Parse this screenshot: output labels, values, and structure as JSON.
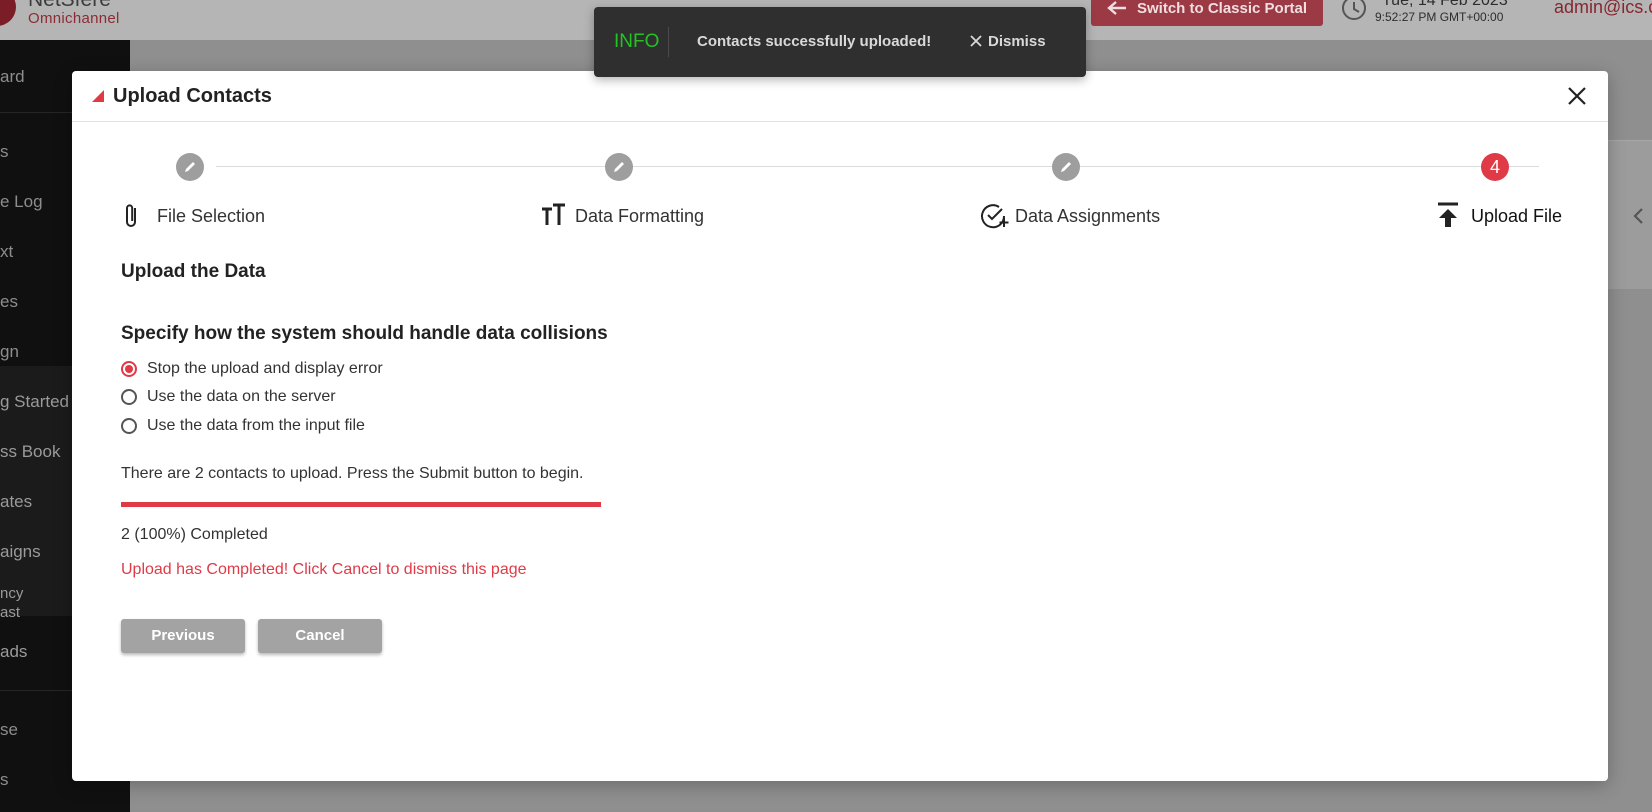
{
  "topbar": {
    "logo_name": "NetSfere",
    "logo_sub": "Omnichannel",
    "classic_portal_label": "Switch to Classic Portal",
    "date": "Tue, 14 Feb 2023",
    "time": "9:52:27 PM GMT+00:00",
    "user": "admin@ics.c"
  },
  "sidebar": {
    "items": [
      "ard",
      "s",
      "e Log",
      "xt",
      "es",
      "gn",
      "g Started",
      "ss Book",
      "ates",
      "aigns",
      "ncy",
      "ast",
      "ads",
      "se",
      "s"
    ]
  },
  "toast": {
    "type": "INFO",
    "message": "Contacts successfully uploaded!",
    "dismiss_label": "Dismiss"
  },
  "modal": {
    "title": "Upload Contacts",
    "steps": [
      {
        "label": "File Selection",
        "icon": "paperclip-icon",
        "state": "edit"
      },
      {
        "label": "Data Formatting",
        "icon": "text-format-icon",
        "state": "edit"
      },
      {
        "label": "Data Assignments",
        "icon": "check-plus-icon",
        "state": "edit"
      },
      {
        "label": "Upload File",
        "icon": "upload-icon",
        "state": "active",
        "number": "4"
      }
    ],
    "section_title": "Upload the Data",
    "question": "Specify how the system should handle data collisions",
    "options": [
      {
        "label": "Stop the upload and display error",
        "checked": true
      },
      {
        "label": "Use the data on the server",
        "checked": false
      },
      {
        "label": "Use the data from the input file",
        "checked": false
      }
    ],
    "info_text": "There are 2 contacts to upload. Press the Submit button to begin.",
    "progress_percent": 100,
    "completed_text": "2 (100%) Completed",
    "completion_message": "Upload has Completed! Click Cancel to dismiss this page",
    "previous_label": "Previous",
    "cancel_label": "Cancel"
  },
  "colors": {
    "accent": "#e03a47",
    "toast_info": "#22c322",
    "toast_bg": "#2f2f2f",
    "button_grey": "#a3a3a3"
  }
}
